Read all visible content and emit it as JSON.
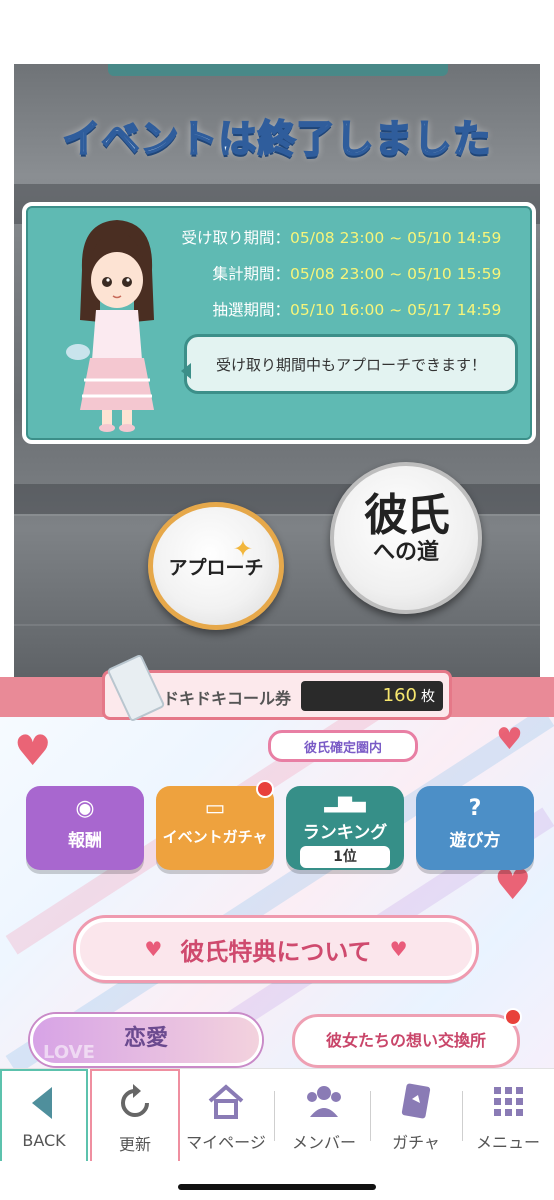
{
  "event": {
    "title": "イベントは終了しました",
    "periods": [
      {
        "label": "受け取り期間：",
        "value": "05/08 23:00 ~ 05/10 14:59"
      },
      {
        "label": "集計期間：",
        "value": "05/08 23:00 ~ 05/10 15:59"
      },
      {
        "label": "抽選期間：",
        "value": "05/10 16:00 ~ 05/17 14:59"
      }
    ],
    "speech": "受け取り期間中もアプローチできます！"
  },
  "actions": {
    "approach": "アプローチ",
    "road_big": "彼氏",
    "road_small": "への道"
  },
  "ticket": {
    "label": "ドキドキコール券",
    "count": "160",
    "unit": "枚"
  },
  "badge": "彼氏確定圏内",
  "menu": {
    "reward": "報酬",
    "event_gacha": "イベントガチャ",
    "ranking": "ランキング",
    "rank_value": "1位",
    "howto": "遊び方",
    "howto_icon": "?"
  },
  "perks": "彼氏特典について",
  "love": "恋愛",
  "love_bg": "LOVE",
  "exchange": "彼女たちの想い交換所",
  "tabs": {
    "back": "BACK",
    "refresh": "更新",
    "mypage": "マイページ",
    "members": "メンバー",
    "gacha": "ガチャ",
    "menu": "メニュー"
  },
  "colors": {
    "teal": "#5fbab3",
    "date_yellow": "#f7f57a",
    "accent_pink": "#e98a97",
    "notification_red": "#e8413b"
  }
}
